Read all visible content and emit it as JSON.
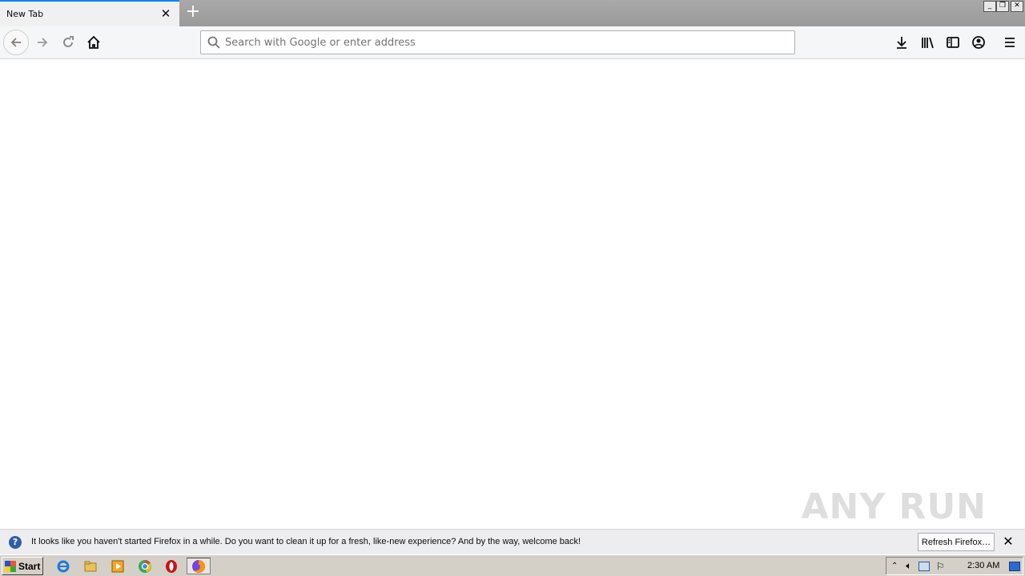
{
  "browser": {
    "tab_title": "New Tab",
    "url_placeholder": "Search with Google or enter address"
  },
  "window_controls": {
    "minimize": "_",
    "restore": "❐",
    "close": "✕"
  },
  "notification": {
    "message": "It looks like you haven't started Firefox in a while. Do you want to clean it up for a fresh, like-new experience? And by the way, welcome back!",
    "button_label": "Refresh Firefox…"
  },
  "watermark": "ANY RUN",
  "taskbar": {
    "start_label": "Start",
    "clock": "2:30 AM",
    "apps": [
      "internet-explorer",
      "file-explorer",
      "media-player",
      "chrome",
      "opera",
      "firefox"
    ]
  },
  "colors": {
    "accent": "#0a84ff",
    "toolbar_bg": "#f5f6f7",
    "titlebar_bg": "#9a9a9a",
    "taskbar_bg": "#d4d0c8"
  }
}
